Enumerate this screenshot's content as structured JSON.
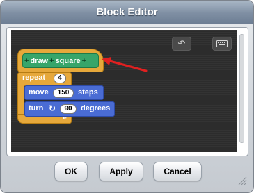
{
  "dialog": {
    "title": "Block Editor"
  },
  "toolbar": {
    "undo_icon": "undo-icon",
    "keyboard_icon": "keyboard-icon"
  },
  "script": {
    "hat": {
      "parts": [
        "+",
        "draw",
        "+",
        "square",
        "+"
      ]
    },
    "repeat": {
      "label": "repeat",
      "count": "4"
    },
    "move": {
      "label": "move",
      "value": "150",
      "suffix": "steps"
    },
    "turn": {
      "label": "turn",
      "icon": "rotate-clockwise-icon",
      "value": "90",
      "suffix": "degrees"
    }
  },
  "annotation": {
    "color": "#e02020"
  },
  "buttons": {
    "ok": "OK",
    "apply": "Apply",
    "cancel": "Cancel"
  },
  "colors": {
    "control": "#e6a83b",
    "custom": "#37a56a",
    "motion": "#4a6cd4"
  }
}
